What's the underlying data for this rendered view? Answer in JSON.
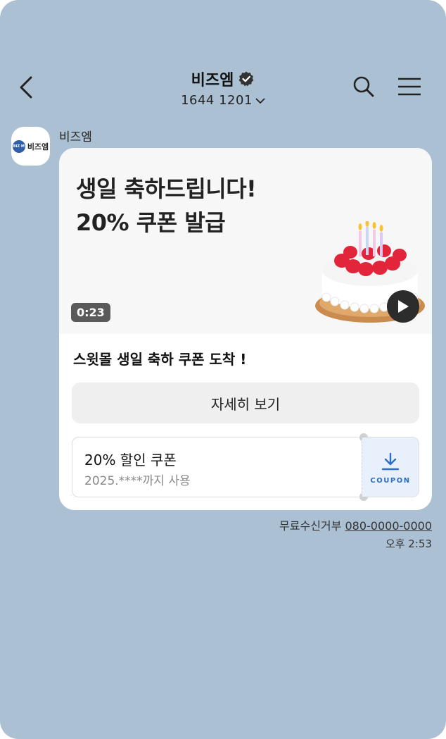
{
  "header": {
    "title": "비즈엠",
    "phone": "1644  1201"
  },
  "sender": {
    "name": "비즈엠",
    "avatar_badge": "BIZ M",
    "avatar_text": "비즈엠"
  },
  "message": {
    "headline_line1": "생일 축하드립니다!",
    "headline_line2": "20% 쿠폰 발급",
    "video_duration": "0:23",
    "text": "스윗몰 생일 축하 쿠폰 도착 !",
    "button_label": "자세히 보기",
    "coupon": {
      "title": "20% 할인 쿠폰",
      "validity": "2025.****까지 사용",
      "download_label": "COUPON"
    }
  },
  "footer": {
    "reject_label": "무료수신거부",
    "reject_number": "080-0000-0000",
    "timestamp": "오후 2:53"
  },
  "icons": {
    "back": "back-arrow-icon",
    "verified": "verified-badge-icon",
    "search": "search-icon",
    "menu": "hamburger-menu-icon",
    "play": "play-icon",
    "download": "download-icon"
  },
  "colors": {
    "background": "#abc1d3",
    "coupon_accent": "#2e6bc4"
  }
}
